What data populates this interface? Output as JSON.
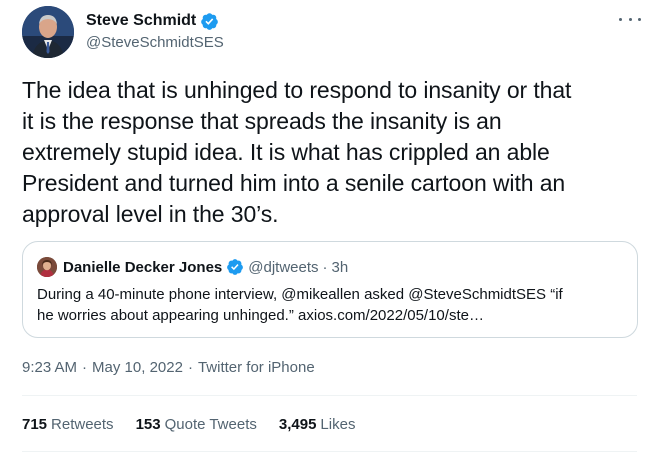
{
  "author": {
    "display_name": "Steve Schmidt",
    "handle": "@SteveSchmidtSES",
    "verified": true
  },
  "tweet": {
    "text_lines": [
      "The idea that is unhinged to respond to insanity or that",
      "it is the response that spreads the insanity is an",
      "extremely stupid idea. It is what has crippled an able",
      "President and turned him into a senile cartoon with an",
      "approval level in the 30’s."
    ]
  },
  "quoted_tweet": {
    "display_name": "Danielle Decker Jones",
    "handle": "@djtweets",
    "separator": "·",
    "time": "3h",
    "text_lines": [
      "During a 40-minute phone interview, @mikeallen asked @SteveSchmidtSES “if",
      "he worries about appearing unhinged.” axios.com/2022/05/10/ste…"
    ]
  },
  "meta": {
    "time": "9:23 AM",
    "separator": "·",
    "date": "May 10, 2022",
    "source": "Twitter for iPhone"
  },
  "stats": {
    "retweets_count": "715",
    "retweets_label": "Retweets",
    "quote_tweets_count": "153",
    "quote_tweets_label": "Quote Tweets",
    "likes_count": "3,495",
    "likes_label": "Likes"
  },
  "colors": {
    "verified_blue": "#1d9bf0",
    "secondary_text": "#536471",
    "primary_text": "#0f1419",
    "border": "#cfd9de"
  },
  "icons": {
    "more": "more-horizontal-icon",
    "verified": "verified-badge-icon"
  }
}
